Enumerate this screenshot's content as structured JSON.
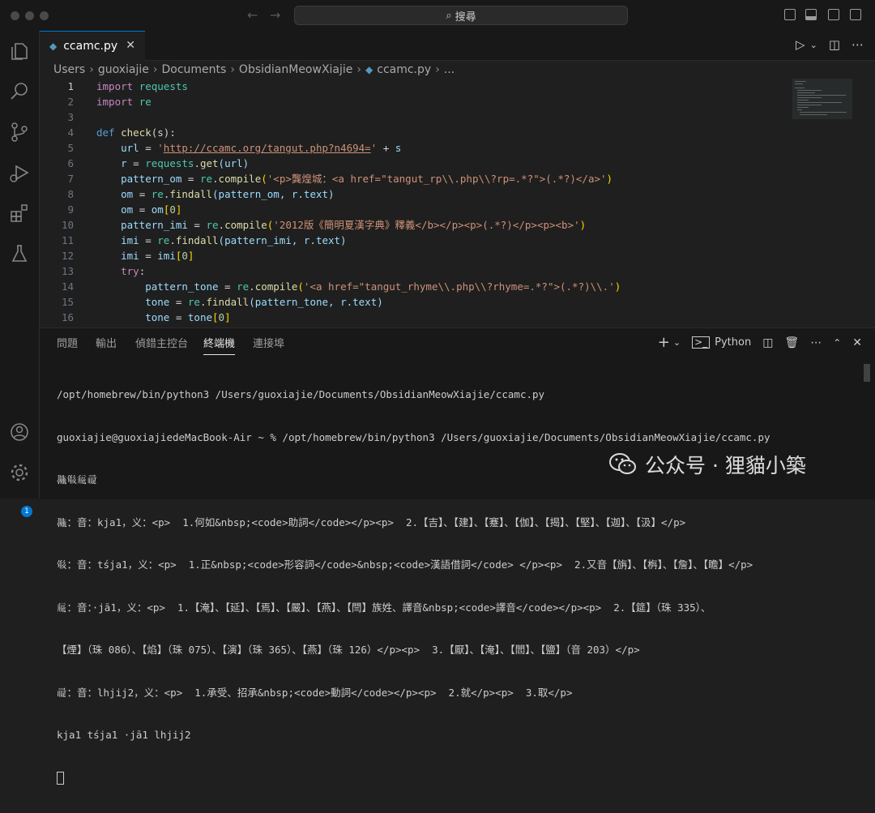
{
  "titlebar": {
    "search_label": "搜尋"
  },
  "tab": {
    "filename": "ccamc.py"
  },
  "breadcrumb": [
    "Users",
    "guoxiajie",
    "Documents",
    "ObsidianMeowXiajie",
    "ccamc.py",
    "..."
  ],
  "code": {
    "line_numbers": [
      "1",
      "2",
      "3",
      "4",
      "5",
      "6",
      "7",
      "8",
      "9",
      "10",
      "11",
      "12",
      "13",
      "14",
      "15",
      "16"
    ],
    "l1": [
      "import",
      "requests"
    ],
    "l2": [
      "import",
      "re"
    ],
    "l4": [
      "def",
      "check",
      "(s):"
    ],
    "l5": [
      "url",
      " = ",
      "'",
      "http://ccamc.org/tangut.php?n4694=",
      "'",
      " + ",
      "s"
    ],
    "l6": [
      "r",
      " = ",
      "requests",
      ".",
      "get",
      "(url)"
    ],
    "l7": [
      "pattern_om",
      " = ",
      "re",
      ".",
      "compile",
      "(",
      "'<p>龔煌城：<a href=\"tangut_rp\\\\.php\\\\?rp=.*?\">(.*?)</a>'",
      ")"
    ],
    "l8": [
      "om",
      " = ",
      "re",
      ".",
      "findall",
      "(pattern_om, r.text)"
    ],
    "l9": [
      "om",
      " = ",
      "om",
      "[",
      "0",
      "]"
    ],
    "l10": [
      "pattern_imi",
      " = ",
      "re",
      ".",
      "compile",
      "(",
      "'2012版《簡明夏漢字典》釋義</b></p><p>(.*?)</p><p><b>'",
      ")"
    ],
    "l11": [
      "imi",
      " = ",
      "re",
      ".",
      "findall",
      "(pattern_imi, r.text)"
    ],
    "l12": [
      "imi",
      " = ",
      "imi",
      "[",
      "0",
      "]"
    ],
    "l13": [
      "try",
      ":"
    ],
    "l14": [
      "pattern_tone",
      " = ",
      "re",
      ".",
      "compile",
      "(",
      "'<a href=\"tangut_rhyme\\\\.php\\\\?rhyme=.*?\">(.*?)\\\\.'",
      ")"
    ],
    "l15": [
      "tone",
      " = ",
      "re",
      ".",
      "findall",
      "(pattern_tone, r.text)"
    ],
    "l16": [
      "tone",
      " = ",
      "tone",
      "[",
      "0",
      "]"
    ]
  },
  "panel": {
    "tabs": [
      "問題",
      "輸出",
      "偵錯主控台",
      "終端機",
      "連接埠"
    ],
    "active_tab": "終端機",
    "python_label": "Python"
  },
  "terminal": {
    "lines": [
      "/opt/homebrew/bin/python3 /Users/guoxiajie/Documents/ObsidianMeowXiajie/ccamc.py",
      "guoxiajie@guoxiajiedeMacBook-Air ~ % /opt/homebrew/bin/python3 /Users/guoxiajie/Documents/ObsidianMeowXiajie/ccamc.py",
      "𗖵𘓐𗏁𗕣",
      "𗖵：音：kja1，义：<p>  1.何如&nbsp;<code>助詞</code></p><p>  2.【吉】、【建】、【蹇】、【伽】、【揭】、【堅】、【迦】、【汲】</p>",
      "𘓐：音：tśja1，义：<p>  1.正&nbsp;<code>形容詞</code>&nbsp;<code>漢語借詞</code> </p><p>  2.又音【旃】、【栴】、【詹】、【瞻】</p>",
      "𗏁：音：·jā1，义：<p>  1.【淹】、【延】、【焉】、【嚴】、【燕】、【閆】族姓、譯音&nbsp;<code>譯音</code></p><p>  2.【筵】（珠 335）、",
      "【煙】（珠 086）、【焰】（珠 075）、【演】（珠 365）、【燕】（珠 126）</p><p>  3.【厭】、【淹】、【閻】、【鹽】（音 203）</p>",
      "𗕣：音：lhjij2，义：<p>  1.承受、招承&nbsp;<code>動詞</code></p><p>  2.就</p><p>  3.取</p>",
      "kja1 tśja1 ·jā1 lhjij2"
    ]
  },
  "watermark": {
    "text": "公众号 · 狸貓小築"
  },
  "badge": {
    "count": "1"
  }
}
